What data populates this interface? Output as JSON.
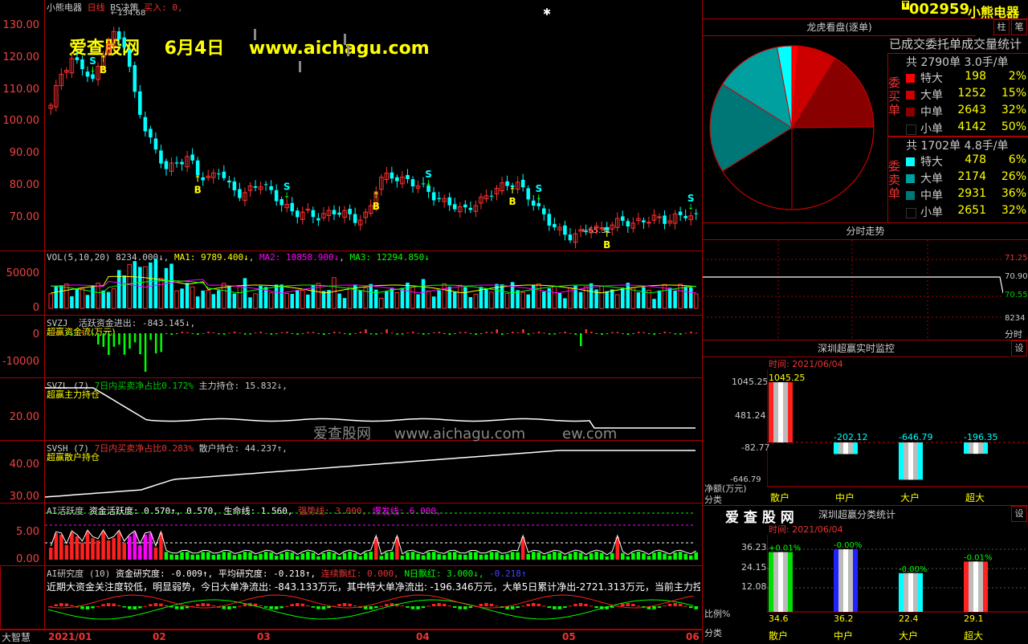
{
  "stock": {
    "name": "小熊电器",
    "period": "日线",
    "strategy": "BS决策",
    "buy_label": "买入: 0,",
    "high_label": "134.68",
    "low_label": "65.31",
    "code": "002959"
  },
  "watermark": {
    "site": "爱查股网",
    "date": "6月4日",
    "url": "www.aichagu.com",
    "center_site": "爱查股网",
    "center_url": "www.aichagu.com",
    "center_extra": "ew.com"
  },
  "price_axis": [
    "130.00",
    "120.00",
    "110.00",
    "100.00",
    "90.00",
    "80.00",
    "70.00"
  ],
  "signals": {
    "buy": "B",
    "sell": "S"
  },
  "vol": {
    "header": "VOL(5,10,20)",
    "value": "8234.000↓",
    "ma1": "MA1: 9789.400↓",
    "ma2": "MA2: 10858.900↓",
    "ma3": "MA3: 12294.850↓",
    "axis": [
      "50000",
      "0"
    ]
  },
  "svzj": {
    "header": "SVZJ",
    "text": "活跃资金进出: -843.145↓,",
    "sub": "超赢资金流(万元)",
    "axis": [
      "0",
      "-10000"
    ]
  },
  "svzl": {
    "header": "SVZL (7)",
    "t1": "7日内买卖净占比0.172%",
    "t2": "主力持仓: 15.832↓,",
    "sub": "超赢主力持仓",
    "axis": [
      "20.00"
    ]
  },
  "svsh": {
    "header": "SVSH (7)",
    "t1": "7日内买卖净占比0.283%",
    "t2": "散户持仓: 44.237↑,",
    "sub": "超赢散户持仓",
    "axis": [
      "40.00",
      "30.00"
    ]
  },
  "ai_active": {
    "header": "AI活跃度",
    "t1": "资金活跃度: 0.570↑, 0.570,",
    "t2": "生命线: 1.560,",
    "t3": "强势线: 3.000,",
    "t4": "爆发线: 6.000,",
    "axis": [
      "5.00",
      "0.00"
    ]
  },
  "ai_research": {
    "header": "AI研究度 (10)",
    "t1": "资金研究度: -0.009↑,",
    "t2": "平均研究度: -0.218↑,",
    "t3": "连续飘红: 0.000,",
    "t4": "N日飘红: 3.000↓,",
    "t5": "-0.218↑",
    "comment": "近期大资金关注度较低，明显弱势，今日大单净流出: -843.133万元，其中特大单净流出: -196.346万元，大单5日累计净出-2721.313万元，当前主力控盘较"
  },
  "xaxis": {
    "corner": "大智慧",
    "labels": [
      "2021/01",
      "02",
      "03",
      "04",
      "05",
      "06"
    ]
  },
  "header_buttons": {
    "b1": "柱",
    "b2": "笔"
  },
  "dragon": {
    "title": "龙虎看盘(逐单)",
    "subtitle": "已成交委托单成交量统计",
    "buy_side": "委买单",
    "sell_side": "委卖单",
    "buy_total": "共 2790单 3.0手/单",
    "sell_total": "共 1702单 4.8手/单",
    "buy_rows": [
      {
        "label": "特大",
        "num": "198",
        "pct": "2%",
        "color": "#ff0000"
      },
      {
        "label": "大单",
        "num": "1252",
        "pct": "15%",
        "color": "#cc0000"
      },
      {
        "label": "中单",
        "num": "2643",
        "pct": "32%",
        "color": "#880000"
      },
      {
        "label": "小单",
        "num": "4142",
        "pct": "50%",
        "color": "#000000"
      }
    ],
    "sell_rows": [
      {
        "label": "特大",
        "num": "478",
        "pct": "6%",
        "color": "#00ffff"
      },
      {
        "label": "大单",
        "num": "2174",
        "pct": "26%",
        "color": "#00a0a0"
      },
      {
        "label": "中单",
        "num": "2931",
        "pct": "36%",
        "color": "#007777"
      },
      {
        "label": "小单",
        "num": "2651",
        "pct": "32%",
        "color": "#000000"
      }
    ]
  },
  "intraday": {
    "title": "分时走势",
    "axis": [
      "71.25",
      "70.90",
      "70.55",
      "8234",
      "分时"
    ]
  },
  "monitor": {
    "title": "深圳超赢实时监控",
    "btn": "设",
    "time": "时间: 2021/06/04",
    "axis": [
      "1045.25",
      "481.24",
      "-82.77",
      "-646.79"
    ],
    "unit": "净额(万元)",
    "cat_label": "分类",
    "bars": [
      {
        "label": "散户",
        "value": "1045.25"
      },
      {
        "label": "中户",
        "value": "-202.12"
      },
      {
        "label": "大户",
        "value": "-646.79"
      },
      {
        "label": "超大",
        "value": "-196.35"
      }
    ]
  },
  "classify": {
    "brand": "爱 查 股 网",
    "title": "深圳超赢分类统计",
    "btn": "设",
    "time": "时间: 2021/06/04",
    "axis": [
      "36.23",
      "24.15",
      "12.08"
    ],
    "ratio_label": "比例%",
    "cat_label": "分类",
    "bars": [
      {
        "label": "散户",
        "top": "+0.01%",
        "value": "34.6",
        "color": "#00dd00"
      },
      {
        "label": "中户",
        "top": "-0.00%",
        "value": "36.2",
        "color": "#2222ff"
      },
      {
        "label": "大户",
        "top": "-0.00%",
        "value": "22.4",
        "color": "#00ffff"
      },
      {
        "label": "超大",
        "top": "-0.01%",
        "value": "29.1",
        "color": "#ff2222"
      }
    ]
  },
  "chart_data": {
    "type": "candlestick",
    "title": "小熊电器 日线",
    "x_range": [
      "2021/01",
      "2021/06/04"
    ],
    "ylim": [
      65,
      135
    ],
    "annotations": [
      {
        "label": "134.68",
        "kind": "high"
      },
      {
        "label": "65.31",
        "kind": "low"
      }
    ],
    "approx_close_path": [
      108,
      118,
      122,
      120,
      115,
      125,
      130,
      127,
      110,
      100,
      93,
      88,
      90,
      92,
      86,
      85,
      88,
      82,
      80,
      82,
      84,
      80,
      77,
      74,
      75,
      73,
      74,
      75,
      74,
      72,
      74,
      85,
      86,
      85,
      84,
      83,
      80,
      78,
      77,
      75,
      77,
      79,
      82,
      83,
      84,
      80,
      76,
      72,
      69,
      67,
      68,
      70,
      69,
      71,
      72,
      71,
      72,
      73,
      72,
      73,
      74,
      73
    ]
  }
}
